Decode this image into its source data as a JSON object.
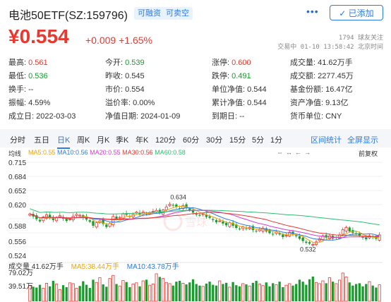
{
  "header": {
    "title": "电池50ETF(SZ:159796)",
    "badges": [
      "可融资",
      "可卖空"
    ],
    "more": "•••",
    "follow_btn": "✓ 已添加"
  },
  "quote": {
    "price": "¥0.554",
    "change": "+0.009",
    "change_pct": "+1.65%",
    "followers": "1794 球友关注",
    "status": "交易中 01-10 13:58:42 北京时间"
  },
  "stats": {
    "high": {
      "label": "最高:",
      "value": "0.561"
    },
    "open": {
      "label": "今开:",
      "value": "0.539"
    },
    "limit_up": {
      "label": "涨停:",
      "value": "0.600"
    },
    "volume": {
      "label": "成交量:",
      "value": "41.62万手"
    },
    "low": {
      "label": "最低:",
      "value": "0.536"
    },
    "prev_close": {
      "label": "昨收:",
      "value": "0.545"
    },
    "limit_down": {
      "label": "跌停:",
      "value": "0.491"
    },
    "turnover": {
      "label": "成交额:",
      "value": "2277.45万"
    },
    "turnover_rate": {
      "label": "换手:",
      "value": "--"
    },
    "mkt_price": {
      "label": "市价:",
      "value": "0.554"
    },
    "unit_nav": {
      "label": "单位净值:",
      "value": "0.544"
    },
    "fund_shares": {
      "label": "基金份额:",
      "value": "16.47亿"
    },
    "amplitude": {
      "label": "振幅:",
      "value": "4.59%"
    },
    "premium": {
      "label": "溢价率:",
      "value": "0.00%"
    },
    "acc_nav": {
      "label": "累计净值:",
      "value": "0.544"
    },
    "net_assets": {
      "label": "资产净值:",
      "value": "9.13亿"
    },
    "est_date": {
      "label": "成立日:",
      "value": "2022-03-03"
    },
    "nav_date": {
      "label": "净值日期:",
      "value": "2024-01-09"
    },
    "maturity": {
      "label": "到期日:",
      "value": "--"
    },
    "currency": {
      "label": "货币单位:",
      "value": "CNY"
    }
  },
  "tabs": [
    "分时",
    "五日",
    "日K",
    "周K",
    "月K",
    "季K",
    "年K",
    "120分",
    "60分",
    "30分",
    "15分",
    "5分",
    "1分"
  ],
  "active_tab": "日K",
  "tools": {
    "stats": "区间统计",
    "fullscreen": "全屏显示",
    "adjust": "前复权"
  },
  "ma_legend": {
    "label": "均线",
    "items": [
      {
        "text": "MA5:0.55",
        "color": "#f0a30a"
      },
      {
        "text": "MA10:0.56",
        "color": "#2d7be5"
      },
      {
        "text": "MA20:0.55",
        "color": "#d63ad6"
      },
      {
        "text": "MA30:0.56",
        "color": "#e8382f"
      },
      {
        "text": "MA60:0.58",
        "color": "#2fbf71"
      }
    ]
  },
  "vol_legend": {
    "items": [
      {
        "text": "成交量 41.62万手",
        "color": "#333333"
      },
      {
        "text": "MA5:38.44万手",
        "color": "#f0a30a"
      },
      {
        "text": "MA10:43.78万手",
        "color": "#2d7be5"
      }
    ]
  },
  "colors": {
    "up": "#e8382f",
    "down": "#1a9b2d",
    "accent": "#2d7be5"
  },
  "chart_data": {
    "type": "candlestick",
    "y_ticks": [
      "0.715",
      "0.684",
      "0.652",
      "0.620",
      "0.588",
      "0.556",
      "0.524"
    ],
    "ylim": [
      0.52,
      0.72
    ],
    "annotations": {
      "high": "0.634",
      "low": "0.532"
    },
    "vol_ticks": [
      "79.02万",
      "39.51万"
    ],
    "closes": [
      0.602,
      0.596,
      0.59,
      0.585,
      0.595,
      0.6,
      0.592,
      0.588,
      0.594,
      0.598,
      0.591,
      0.586,
      0.59,
      0.597,
      0.601,
      0.599,
      0.593,
      0.589,
      0.584,
      0.575,
      0.582,
      0.586,
      0.579,
      0.572,
      0.58,
      0.596,
      0.591,
      0.594,
      0.602,
      0.6,
      0.595,
      0.601,
      0.606,
      0.6,
      0.606,
      0.602,
      0.605,
      0.608,
      0.61,
      0.604,
      0.611,
      0.618,
      0.624,
      0.622,
      0.618,
      0.614,
      0.621,
      0.616,
      0.61,
      0.605,
      0.6,
      0.598,
      0.602,
      0.595,
      0.593,
      0.588,
      0.583,
      0.586,
      0.58,
      0.576,
      0.582,
      0.575,
      0.57,
      0.567,
      0.572,
      0.568,
      0.571,
      0.565,
      0.562,
      0.566,
      0.569,
      0.562,
      0.558,
      0.556,
      0.561,
      0.555,
      0.549,
      0.553,
      0.56,
      0.556,
      0.551,
      0.545,
      0.54,
      0.536,
      0.534,
      0.532,
      0.538,
      0.545,
      0.552,
      0.548,
      0.552,
      0.546,
      0.548,
      0.554,
      0.566,
      0.571,
      0.562,
      0.559,
      0.556,
      0.552,
      0.548,
      0.544,
      0.552,
      0.549,
      0.545,
      0.554
    ],
    "volumes": [
      40,
      37,
      35,
      42,
      33,
      46,
      38,
      52,
      44,
      30,
      41,
      36,
      47,
      45,
      33,
      39,
      51,
      42,
      34,
      55,
      48,
      60,
      43,
      37,
      58,
      66,
      44,
      39,
      53,
      49,
      36,
      44,
      47,
      38,
      52,
      55,
      41,
      44,
      70,
      62,
      58,
      48,
      45,
      40,
      50,
      52,
      46,
      43,
      48,
      56,
      44,
      40,
      38,
      45,
      50,
      42,
      40,
      52,
      44,
      47,
      36,
      49,
      41,
      38,
      45,
      43,
      39,
      47,
      52,
      44,
      40,
      48,
      38,
      46,
      42,
      50,
      36,
      41,
      45,
      40,
      44,
      55,
      50,
      42,
      56,
      63,
      48,
      45,
      52,
      46,
      60,
      50,
      45,
      54,
      72,
      62,
      48,
      40,
      44,
      46,
      38,
      44,
      50,
      40,
      35,
      42
    ]
  }
}
